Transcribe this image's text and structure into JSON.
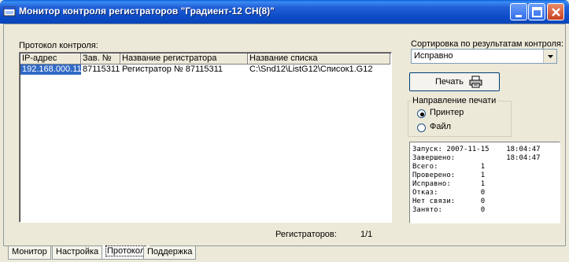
{
  "window": {
    "title": "Монитор контроля регистраторов \"Градиент-12 СН(8)\""
  },
  "protocol": {
    "label": "Протокол контроля:",
    "columns": [
      "IP-адрес",
      "Зав. №",
      "Название регистратора",
      "Название списка"
    ],
    "rows": [
      [
        "192.168.000.111",
        "87115311",
        "Регистратор № 87115311",
        "C:\\Snd12\\ListG12\\Список1.G12"
      ]
    ],
    "count_label": "Регистраторов:",
    "count_value": "1/1"
  },
  "sort": {
    "label": "Сортировка по результатам контроля:",
    "value": "Исправно"
  },
  "print": {
    "button_label": "Печать",
    "direction_label": "Направление печати",
    "options": [
      {
        "label": "Принтер",
        "selected": true
      },
      {
        "label": "Файл",
        "selected": false
      }
    ]
  },
  "stats": {
    "rows": [
      "Запуск: 2007-11-15    18:04:47",
      "Завершено:            18:04:47",
      "Всего:          1",
      "Проверено:      1",
      "Исправно:       1",
      "Отказ:          0",
      "Нет связи:      0",
      "Занято:         0"
    ]
  },
  "tabs": [
    {
      "label": "Монитор",
      "active": false
    },
    {
      "label": "Настройка",
      "active": false
    },
    {
      "label": "Протокол",
      "active": true
    },
    {
      "label": "Поддержка",
      "active": false
    }
  ],
  "icons": {
    "app": "app-window-icon",
    "printer": "printer-icon",
    "minimize": "minimize-icon",
    "maximize": "maximize-icon",
    "close": "close-icon",
    "dropdown": "chevron-down-icon"
  },
  "colors": {
    "titlebar": "#0a5fd7",
    "selection": "#316ac5",
    "window_bg": "#ece9d8"
  }
}
